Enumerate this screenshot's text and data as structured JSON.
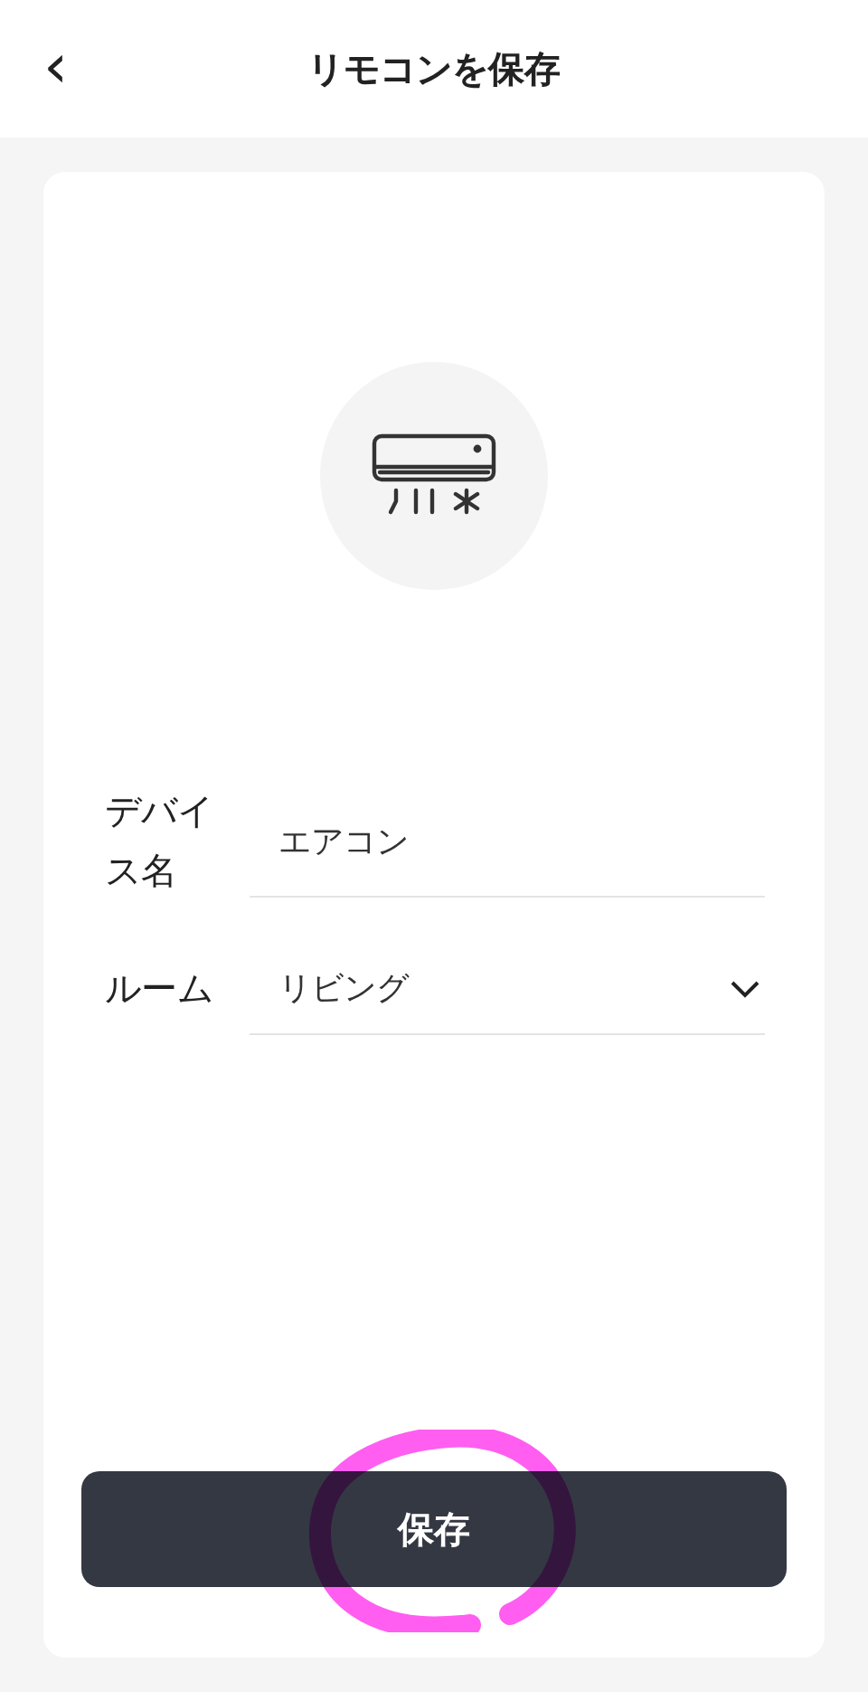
{
  "header": {
    "back_icon": "‹",
    "title": "リモコンを保存"
  },
  "fields": [
    {
      "kind": "text",
      "label": "デバイス名",
      "value": "エアコン"
    },
    {
      "kind": "select",
      "label": "ルーム",
      "value": "リビング"
    }
  ],
  "save_button": {
    "label": "保存"
  },
  "annotation": {
    "kind": "circle"
  }
}
